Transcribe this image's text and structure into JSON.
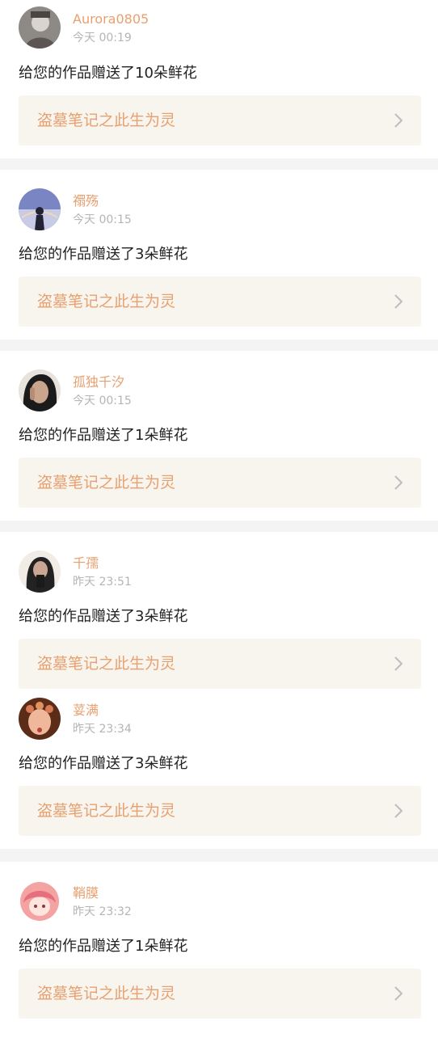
{
  "notifications": [
    {
      "username": "Aurora0805",
      "time": "今天 00:19",
      "message": "给您的作品赠送了10朵鲜花",
      "work_title": "盗墓笔记之此生为灵",
      "avatar_colors": [
        "#8d8a86",
        "#d9d4cf",
        "#5c5552"
      ]
    },
    {
      "username": "禤殇",
      "time": "今天 00:15",
      "message": "给您的作品赠送了3朵鲜花",
      "work_title": "盗墓笔记之此生为灵",
      "avatar_colors": [
        "#7a86c4",
        "#c7cbe6",
        "#222233"
      ]
    },
    {
      "username": "孤独千汐",
      "time": "今天 00:15",
      "message": "给您的作品赠送了1朵鲜花",
      "work_title": "盗墓笔记之此生为灵",
      "avatar_colors": [
        "#e8e2dc",
        "#1c1b1b",
        "#c9a58e"
      ]
    },
    {
      "username": "千孺",
      "time": "昨天 23:51",
      "message": "给您的作品赠送了3朵鲜花",
      "work_title": "盗墓笔记之此生为灵",
      "avatar_colors": [
        "#f2ece6",
        "#222222",
        "#caa693"
      ]
    },
    {
      "username": "荽满",
      "time": "昨天 23:34",
      "message": "给您的作品赠送了3朵鲜花",
      "work_title": "盗墓笔记之此生为灵",
      "avatar_colors": [
        "#5b2d18",
        "#d87a53",
        "#f0b89a"
      ]
    },
    {
      "username": "鞘膜",
      "time": "昨天 23:32",
      "message": "给您的作品赠送了1朵鲜花",
      "work_title": "盗墓笔记之此生为灵",
      "avatar_colors": [
        "#f4a3a3",
        "#ffffff",
        "#e76f7d"
      ]
    }
  ],
  "colors": {
    "accent": "#e8a070",
    "card_bg": "#f7f5ee",
    "separator": "#f4f4f4",
    "message_text": "#222222",
    "timestamp_text": "#b5b5b5",
    "chevron": "#bdbdbd"
  }
}
